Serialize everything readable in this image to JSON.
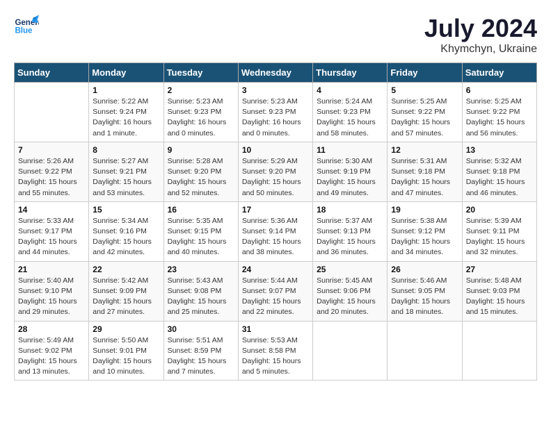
{
  "header": {
    "logo_line1": "General",
    "logo_line2": "Blue",
    "month_year": "July 2024",
    "location": "Khymchyn, Ukraine"
  },
  "weekdays": [
    "Sunday",
    "Monday",
    "Tuesday",
    "Wednesday",
    "Thursday",
    "Friday",
    "Saturday"
  ],
  "weeks": [
    [
      {
        "day": "",
        "info": ""
      },
      {
        "day": "1",
        "info": "Sunrise: 5:22 AM\nSunset: 9:24 PM\nDaylight: 16 hours\nand 1 minute."
      },
      {
        "day": "2",
        "info": "Sunrise: 5:23 AM\nSunset: 9:23 PM\nDaylight: 16 hours\nand 0 minutes."
      },
      {
        "day": "3",
        "info": "Sunrise: 5:23 AM\nSunset: 9:23 PM\nDaylight: 16 hours\nand 0 minutes."
      },
      {
        "day": "4",
        "info": "Sunrise: 5:24 AM\nSunset: 9:23 PM\nDaylight: 15 hours\nand 58 minutes."
      },
      {
        "day": "5",
        "info": "Sunrise: 5:25 AM\nSunset: 9:22 PM\nDaylight: 15 hours\nand 57 minutes."
      },
      {
        "day": "6",
        "info": "Sunrise: 5:25 AM\nSunset: 9:22 PM\nDaylight: 15 hours\nand 56 minutes."
      }
    ],
    [
      {
        "day": "7",
        "info": "Sunrise: 5:26 AM\nSunset: 9:22 PM\nDaylight: 15 hours\nand 55 minutes."
      },
      {
        "day": "8",
        "info": "Sunrise: 5:27 AM\nSunset: 9:21 PM\nDaylight: 15 hours\nand 53 minutes."
      },
      {
        "day": "9",
        "info": "Sunrise: 5:28 AM\nSunset: 9:20 PM\nDaylight: 15 hours\nand 52 minutes."
      },
      {
        "day": "10",
        "info": "Sunrise: 5:29 AM\nSunset: 9:20 PM\nDaylight: 15 hours\nand 50 minutes."
      },
      {
        "day": "11",
        "info": "Sunrise: 5:30 AM\nSunset: 9:19 PM\nDaylight: 15 hours\nand 49 minutes."
      },
      {
        "day": "12",
        "info": "Sunrise: 5:31 AM\nSunset: 9:18 PM\nDaylight: 15 hours\nand 47 minutes."
      },
      {
        "day": "13",
        "info": "Sunrise: 5:32 AM\nSunset: 9:18 PM\nDaylight: 15 hours\nand 46 minutes."
      }
    ],
    [
      {
        "day": "14",
        "info": "Sunrise: 5:33 AM\nSunset: 9:17 PM\nDaylight: 15 hours\nand 44 minutes."
      },
      {
        "day": "15",
        "info": "Sunrise: 5:34 AM\nSunset: 9:16 PM\nDaylight: 15 hours\nand 42 minutes."
      },
      {
        "day": "16",
        "info": "Sunrise: 5:35 AM\nSunset: 9:15 PM\nDaylight: 15 hours\nand 40 minutes."
      },
      {
        "day": "17",
        "info": "Sunrise: 5:36 AM\nSunset: 9:14 PM\nDaylight: 15 hours\nand 38 minutes."
      },
      {
        "day": "18",
        "info": "Sunrise: 5:37 AM\nSunset: 9:13 PM\nDaylight: 15 hours\nand 36 minutes."
      },
      {
        "day": "19",
        "info": "Sunrise: 5:38 AM\nSunset: 9:12 PM\nDaylight: 15 hours\nand 34 minutes."
      },
      {
        "day": "20",
        "info": "Sunrise: 5:39 AM\nSunset: 9:11 PM\nDaylight: 15 hours\nand 32 minutes."
      }
    ],
    [
      {
        "day": "21",
        "info": "Sunrise: 5:40 AM\nSunset: 9:10 PM\nDaylight: 15 hours\nand 29 minutes."
      },
      {
        "day": "22",
        "info": "Sunrise: 5:42 AM\nSunset: 9:09 PM\nDaylight: 15 hours\nand 27 minutes."
      },
      {
        "day": "23",
        "info": "Sunrise: 5:43 AM\nSunset: 9:08 PM\nDaylight: 15 hours\nand 25 minutes."
      },
      {
        "day": "24",
        "info": "Sunrise: 5:44 AM\nSunset: 9:07 PM\nDaylight: 15 hours\nand 22 minutes."
      },
      {
        "day": "25",
        "info": "Sunrise: 5:45 AM\nSunset: 9:06 PM\nDaylight: 15 hours\nand 20 minutes."
      },
      {
        "day": "26",
        "info": "Sunrise: 5:46 AM\nSunset: 9:05 PM\nDaylight: 15 hours\nand 18 minutes."
      },
      {
        "day": "27",
        "info": "Sunrise: 5:48 AM\nSunset: 9:03 PM\nDaylight: 15 hours\nand 15 minutes."
      }
    ],
    [
      {
        "day": "28",
        "info": "Sunrise: 5:49 AM\nSunset: 9:02 PM\nDaylight: 15 hours\nand 13 minutes."
      },
      {
        "day": "29",
        "info": "Sunrise: 5:50 AM\nSunset: 9:01 PM\nDaylight: 15 hours\nand 10 minutes."
      },
      {
        "day": "30",
        "info": "Sunrise: 5:51 AM\nSunset: 8:59 PM\nDaylight: 15 hours\nand 7 minutes."
      },
      {
        "day": "31",
        "info": "Sunrise: 5:53 AM\nSunset: 8:58 PM\nDaylight: 15 hours\nand 5 minutes."
      },
      {
        "day": "",
        "info": ""
      },
      {
        "day": "",
        "info": ""
      },
      {
        "day": "",
        "info": ""
      }
    ]
  ]
}
